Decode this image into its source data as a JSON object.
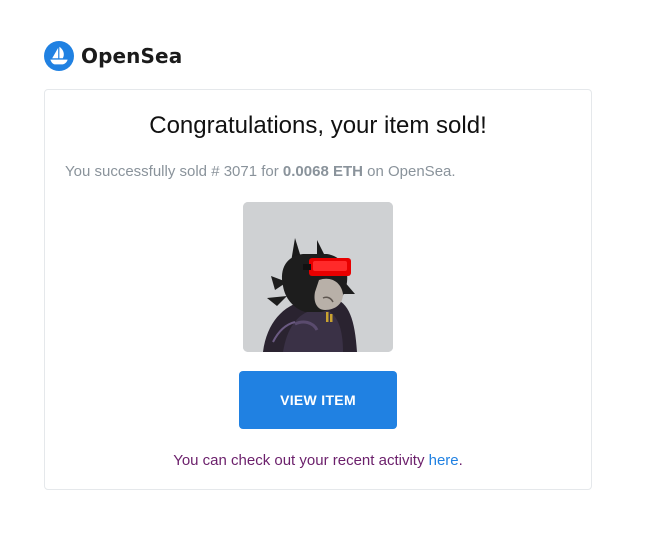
{
  "brand": {
    "name": "OpenSea",
    "logo_icon": "opensea-logo-icon",
    "accent": "#2081e2"
  },
  "card": {
    "title": "Congratulations, your item sold!",
    "message": {
      "prefix": "You successfully sold # 3071 for ",
      "amount": "0.0068 ETH",
      "suffix": " on OpenSea."
    },
    "nft_image_icon": "nft-wolf-avatar",
    "view_button_label": "VIEW ITEM",
    "activity": {
      "prefix": "You can check out your recent activity ",
      "link_text": "here",
      "suffix": "."
    }
  }
}
